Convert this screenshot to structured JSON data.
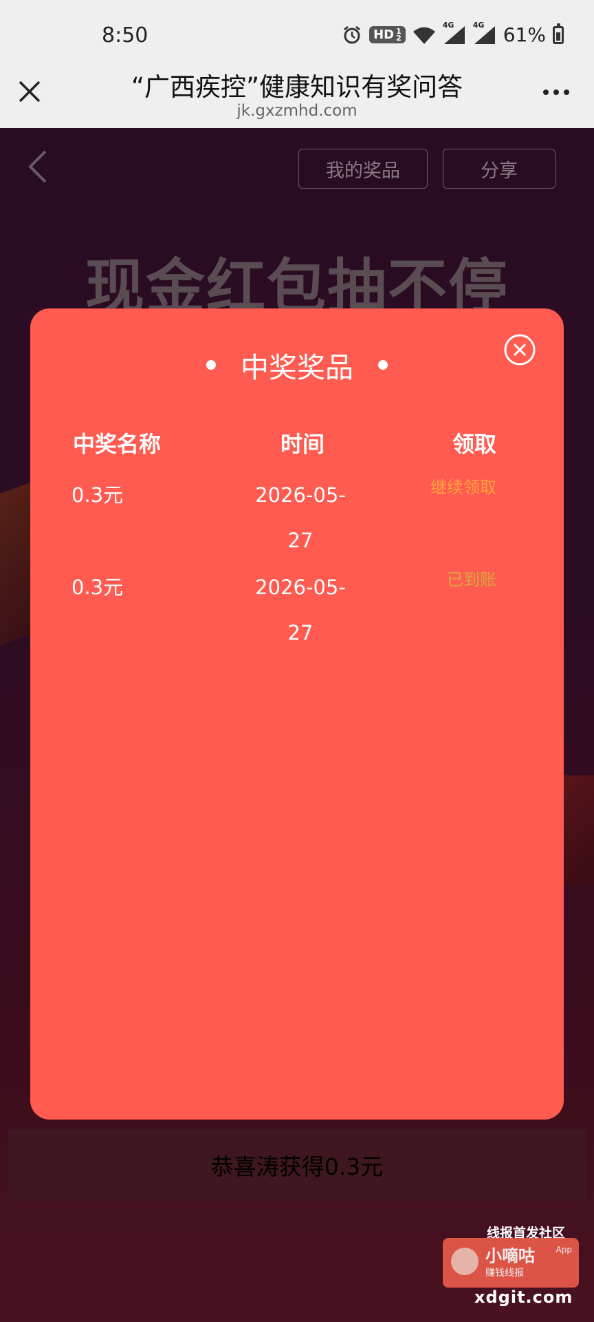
{
  "status_bar": {
    "time": "8:50",
    "hd_label": "HD",
    "hd_fraction_top": "1",
    "hd_fraction_bottom": "2",
    "signal_1_label": "4G",
    "signal_2_label": "4G",
    "battery": "61%"
  },
  "browser": {
    "title": "“广西疾控”健康知识有奖问答",
    "url": "jk.gxzmhd.com"
  },
  "background_page": {
    "my_prizes_button": "我的奖品",
    "share_button": "分享",
    "banner_title": "现金红包抽不停",
    "congrats_message": "恭喜涛获得0.3元"
  },
  "modal": {
    "title": "中奖奖品",
    "columns": {
      "name": "中奖名称",
      "time": "时间",
      "claim": "领取"
    },
    "rows": [
      {
        "name": "0.3元",
        "time": "2026-05-27",
        "claim": "继续领取"
      },
      {
        "name": "0.3元",
        "time": "2026-05-27",
        "claim": "已到账"
      }
    ]
  },
  "watermark": {
    "tagline": "线报首发社区",
    "brand": "小嘀咕",
    "app": "App",
    "sub": "赚钱线报",
    "domain": "xdgit.com"
  },
  "colors": {
    "modal_bg": "#ff5b50",
    "claim_continue": "#ffa43b",
    "claim_arrived": "#d9a83a"
  }
}
